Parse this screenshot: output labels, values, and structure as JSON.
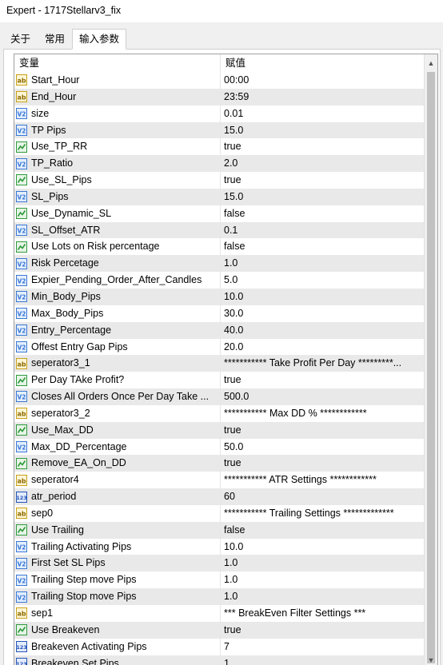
{
  "window": {
    "title": "Expert - 1717Stellarv3_fix"
  },
  "tabs": [
    {
      "label": "关于"
    },
    {
      "label": "常用"
    },
    {
      "label": "输入参数"
    }
  ],
  "grid": {
    "columns": {
      "variable": "变量",
      "value": "赋值"
    },
    "rows": [
      {
        "icon": "ab",
        "name": "Start_Hour",
        "value": "00:00"
      },
      {
        "icon": "ab",
        "name": "End_Hour",
        "value": "23:59"
      },
      {
        "icon": "v2",
        "name": "size",
        "value": "0.01"
      },
      {
        "icon": "v2",
        "name": "TP Pips",
        "value": "15.0"
      },
      {
        "icon": "bool",
        "name": "Use_TP_RR",
        "value": "true"
      },
      {
        "icon": "v2",
        "name": "TP_Ratio",
        "value": "2.0"
      },
      {
        "icon": "bool",
        "name": "Use_SL_Pips",
        "value": "true"
      },
      {
        "icon": "v2",
        "name": "SL_Pips",
        "value": "15.0"
      },
      {
        "icon": "bool",
        "name": "Use_Dynamic_SL",
        "value": "false"
      },
      {
        "icon": "v2",
        "name": "SL_Offset_ATR",
        "value": "0.1"
      },
      {
        "icon": "bool",
        "name": "Use Lots on Risk percentage",
        "value": "false"
      },
      {
        "icon": "v2",
        "name": "Risk Percetage",
        "value": "1.0"
      },
      {
        "icon": "v2",
        "name": "Expier_Pending_Order_After_Candles",
        "value": "5.0"
      },
      {
        "icon": "v2",
        "name": "Min_Body_Pips",
        "value": "10.0"
      },
      {
        "icon": "v2",
        "name": "Max_Body_Pips",
        "value": "30.0"
      },
      {
        "icon": "v2",
        "name": "Entry_Percentage",
        "value": "40.0"
      },
      {
        "icon": "v2",
        "name": "Offest Entry Gap Pips",
        "value": "20.0"
      },
      {
        "icon": "ab",
        "name": "seperator3_1",
        "value": "***********   Take Profit Per Day   *********..."
      },
      {
        "icon": "bool",
        "name": "Per Day TAke Profit?",
        "value": "true"
      },
      {
        "icon": "v2",
        "name": "Closes All Orders Once Per Day Take ...",
        "value": "500.0"
      },
      {
        "icon": "ab",
        "name": "seperator3_2",
        "value": "***********   Max DD %   ************"
      },
      {
        "icon": "bool",
        "name": "Use_Max_DD",
        "value": "true"
      },
      {
        "icon": "v2",
        "name": "Max_DD_Percentage",
        "value": "50.0"
      },
      {
        "icon": "bool",
        "name": "Remove_EA_On_DD",
        "value": "true"
      },
      {
        "icon": "ab",
        "name": "seperator4",
        "value": "***********   ATR Settings   ************"
      },
      {
        "icon": "int",
        "name": "atr_period",
        "value": "60"
      },
      {
        "icon": "ab",
        "name": "sep0",
        "value": "*********** Trailing Settings *************"
      },
      {
        "icon": "bool",
        "name": "Use Trailing",
        "value": "false"
      },
      {
        "icon": "v2",
        "name": "Trailing Activating Pips",
        "value": "10.0"
      },
      {
        "icon": "v2",
        "name": "First Set SL  Pips",
        "value": "1.0"
      },
      {
        "icon": "v2",
        "name": "Trailing Step move Pips",
        "value": "1.0"
      },
      {
        "icon": "v2",
        "name": "Trailing Stop move Pips",
        "value": "1.0"
      },
      {
        "icon": "ab",
        "name": "sep1",
        "value": "*** BreakEven Filter Settings ***"
      },
      {
        "icon": "bool",
        "name": "Use Breakeven",
        "value": "true"
      },
      {
        "icon": "int",
        "name": "Breakeven Activating Pips",
        "value": "7"
      },
      {
        "icon": "int",
        "name": "Breakeven Set Pips",
        "value": "1"
      }
    ]
  },
  "colors": {
    "row_alt": "#e9e9e9",
    "icon_ab": "#c8a018",
    "icon_v2": "#3a78d4",
    "icon_bool": "#2f9a3c",
    "icon_int": "#2456b8"
  }
}
